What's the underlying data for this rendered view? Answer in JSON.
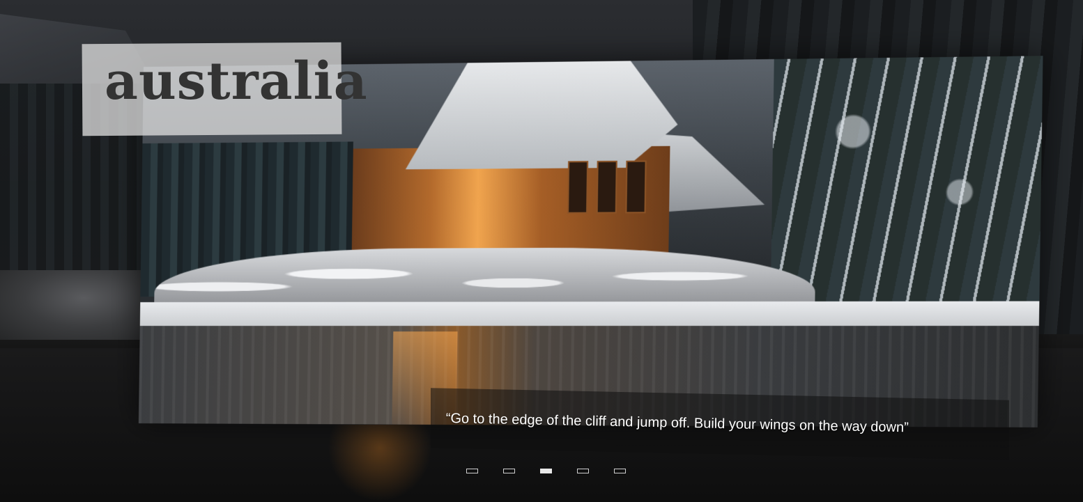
{
  "slider": {
    "title": "australia",
    "caption": "“Go to the edge of the cliff and jump off. Build your wings on the way down”",
    "active_index": 2,
    "pagination": [
      {
        "label": "slide-1"
      },
      {
        "label": "slide-2"
      },
      {
        "label": "slide-3"
      },
      {
        "label": "slide-4"
      },
      {
        "label": "slide-5"
      }
    ]
  },
  "colors": {
    "title_box": "#e1e1e1",
    "title_text": "#333333",
    "caption_text": "#ffffff",
    "dot_border": "#cfcfcf",
    "dot_active": "#e8e8e8"
  },
  "image": {
    "subject": "snow-covered-cabin-by-lake"
  }
}
